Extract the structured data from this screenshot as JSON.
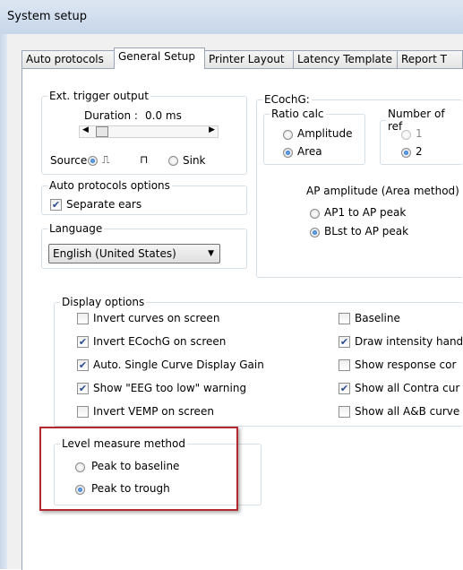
{
  "window": {
    "title": "System setup"
  },
  "tabs": [
    {
      "label": "Auto protocols"
    },
    {
      "label": "General Setup"
    },
    {
      "label": "Printer Layout"
    },
    {
      "label": "Latency Template"
    },
    {
      "label": "Report T"
    }
  ],
  "ext_trigger": {
    "legend": "Ext. trigger output",
    "duration_label": "Duration :",
    "duration_value": "0.0 ms",
    "source_label": "Source",
    "pos_glyph": "⎍",
    "neg_glyph": "⊓",
    "sink_label": "Sink"
  },
  "auto_protocols_options": {
    "legend": "Auto protocols options",
    "separate_ears": "Separate ears"
  },
  "language": {
    "legend": "Language",
    "value": "English (United States)"
  },
  "ecochg": {
    "legend": "ECochG:",
    "ratio_calc": {
      "legend": "Ratio calc",
      "amplitude": "Amplitude",
      "area": "Area"
    },
    "number_of_ref": {
      "legend": "Number of ref",
      "one": "1",
      "two": "2"
    },
    "ap_amplitude": {
      "legend": "AP amplitude (Area method)",
      "ap1": "AP1 to AP peak",
      "blst": "BLst to AP peak"
    }
  },
  "display_options": {
    "legend": "Display options",
    "left": [
      {
        "label": "Invert curves on screen",
        "checked": false
      },
      {
        "label": "Invert ECochG on screen",
        "checked": true
      },
      {
        "label": "Auto. Single Curve Display Gain",
        "checked": true
      },
      {
        "label": "Show \"EEG too low\" warning",
        "checked": true
      },
      {
        "label": "Invert VEMP on screen",
        "checked": false
      }
    ],
    "right": [
      {
        "label": "Baseline",
        "checked": false
      },
      {
        "label": "Draw intensity hand",
        "checked": true
      },
      {
        "label": "Show response cor",
        "checked": false
      },
      {
        "label": "Show all Contra cur",
        "checked": true
      },
      {
        "label": "Show all A&B curve",
        "checked": false
      }
    ]
  },
  "level_measure": {
    "legend": "Level measure method",
    "peak_to_baseline": "Peak to baseline",
    "peak_to_trough": "Peak to trough"
  },
  "colors": {
    "highlight": "#b22a2f",
    "title_bar": "#c7d6ea"
  }
}
